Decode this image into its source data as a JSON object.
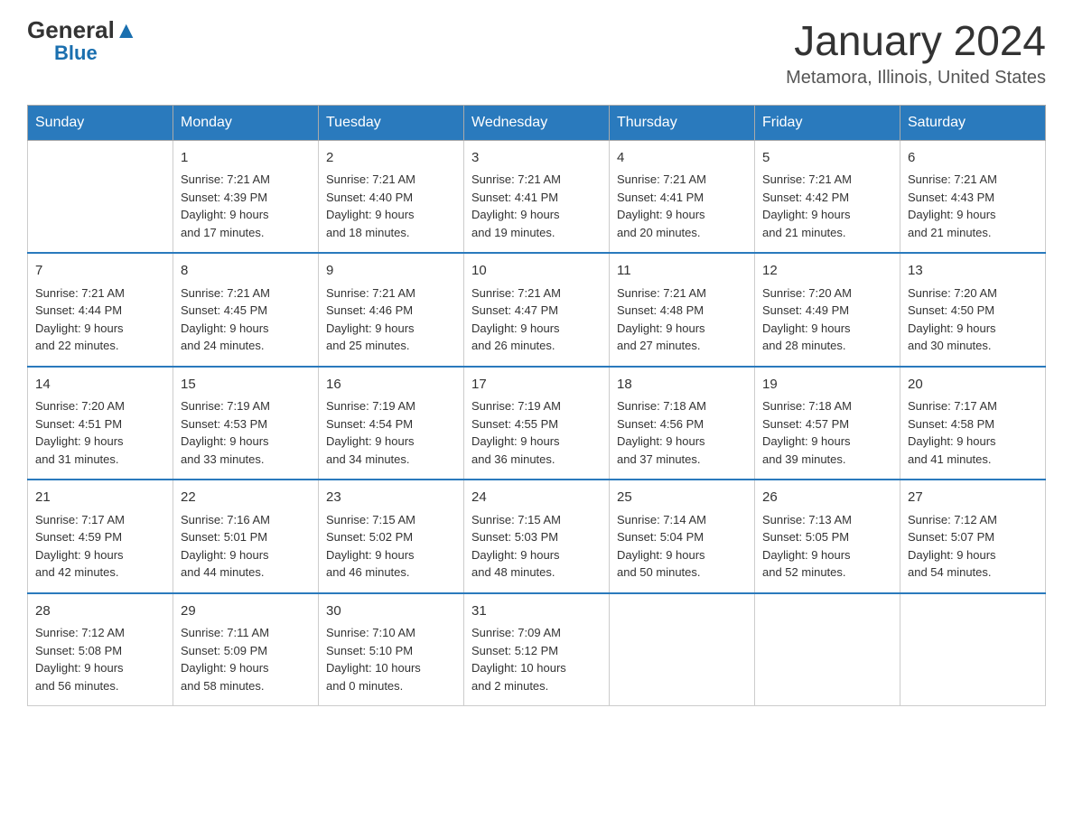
{
  "header": {
    "logo_general": "General",
    "logo_blue": "Blue",
    "title": "January 2024",
    "subtitle": "Metamora, Illinois, United States"
  },
  "days_of_week": [
    "Sunday",
    "Monday",
    "Tuesday",
    "Wednesday",
    "Thursday",
    "Friday",
    "Saturday"
  ],
  "weeks": [
    [
      {
        "day": "",
        "info": ""
      },
      {
        "day": "1",
        "info": "Sunrise: 7:21 AM\nSunset: 4:39 PM\nDaylight: 9 hours\nand 17 minutes."
      },
      {
        "day": "2",
        "info": "Sunrise: 7:21 AM\nSunset: 4:40 PM\nDaylight: 9 hours\nand 18 minutes."
      },
      {
        "day": "3",
        "info": "Sunrise: 7:21 AM\nSunset: 4:41 PM\nDaylight: 9 hours\nand 19 minutes."
      },
      {
        "day": "4",
        "info": "Sunrise: 7:21 AM\nSunset: 4:41 PM\nDaylight: 9 hours\nand 20 minutes."
      },
      {
        "day": "5",
        "info": "Sunrise: 7:21 AM\nSunset: 4:42 PM\nDaylight: 9 hours\nand 21 minutes."
      },
      {
        "day": "6",
        "info": "Sunrise: 7:21 AM\nSunset: 4:43 PM\nDaylight: 9 hours\nand 21 minutes."
      }
    ],
    [
      {
        "day": "7",
        "info": "Sunrise: 7:21 AM\nSunset: 4:44 PM\nDaylight: 9 hours\nand 22 minutes."
      },
      {
        "day": "8",
        "info": "Sunrise: 7:21 AM\nSunset: 4:45 PM\nDaylight: 9 hours\nand 24 minutes."
      },
      {
        "day": "9",
        "info": "Sunrise: 7:21 AM\nSunset: 4:46 PM\nDaylight: 9 hours\nand 25 minutes."
      },
      {
        "day": "10",
        "info": "Sunrise: 7:21 AM\nSunset: 4:47 PM\nDaylight: 9 hours\nand 26 minutes."
      },
      {
        "day": "11",
        "info": "Sunrise: 7:21 AM\nSunset: 4:48 PM\nDaylight: 9 hours\nand 27 minutes."
      },
      {
        "day": "12",
        "info": "Sunrise: 7:20 AM\nSunset: 4:49 PM\nDaylight: 9 hours\nand 28 minutes."
      },
      {
        "day": "13",
        "info": "Sunrise: 7:20 AM\nSunset: 4:50 PM\nDaylight: 9 hours\nand 30 minutes."
      }
    ],
    [
      {
        "day": "14",
        "info": "Sunrise: 7:20 AM\nSunset: 4:51 PM\nDaylight: 9 hours\nand 31 minutes."
      },
      {
        "day": "15",
        "info": "Sunrise: 7:19 AM\nSunset: 4:53 PM\nDaylight: 9 hours\nand 33 minutes."
      },
      {
        "day": "16",
        "info": "Sunrise: 7:19 AM\nSunset: 4:54 PM\nDaylight: 9 hours\nand 34 minutes."
      },
      {
        "day": "17",
        "info": "Sunrise: 7:19 AM\nSunset: 4:55 PM\nDaylight: 9 hours\nand 36 minutes."
      },
      {
        "day": "18",
        "info": "Sunrise: 7:18 AM\nSunset: 4:56 PM\nDaylight: 9 hours\nand 37 minutes."
      },
      {
        "day": "19",
        "info": "Sunrise: 7:18 AM\nSunset: 4:57 PM\nDaylight: 9 hours\nand 39 minutes."
      },
      {
        "day": "20",
        "info": "Sunrise: 7:17 AM\nSunset: 4:58 PM\nDaylight: 9 hours\nand 41 minutes."
      }
    ],
    [
      {
        "day": "21",
        "info": "Sunrise: 7:17 AM\nSunset: 4:59 PM\nDaylight: 9 hours\nand 42 minutes."
      },
      {
        "day": "22",
        "info": "Sunrise: 7:16 AM\nSunset: 5:01 PM\nDaylight: 9 hours\nand 44 minutes."
      },
      {
        "day": "23",
        "info": "Sunrise: 7:15 AM\nSunset: 5:02 PM\nDaylight: 9 hours\nand 46 minutes."
      },
      {
        "day": "24",
        "info": "Sunrise: 7:15 AM\nSunset: 5:03 PM\nDaylight: 9 hours\nand 48 minutes."
      },
      {
        "day": "25",
        "info": "Sunrise: 7:14 AM\nSunset: 5:04 PM\nDaylight: 9 hours\nand 50 minutes."
      },
      {
        "day": "26",
        "info": "Sunrise: 7:13 AM\nSunset: 5:05 PM\nDaylight: 9 hours\nand 52 minutes."
      },
      {
        "day": "27",
        "info": "Sunrise: 7:12 AM\nSunset: 5:07 PM\nDaylight: 9 hours\nand 54 minutes."
      }
    ],
    [
      {
        "day": "28",
        "info": "Sunrise: 7:12 AM\nSunset: 5:08 PM\nDaylight: 9 hours\nand 56 minutes."
      },
      {
        "day": "29",
        "info": "Sunrise: 7:11 AM\nSunset: 5:09 PM\nDaylight: 9 hours\nand 58 minutes."
      },
      {
        "day": "30",
        "info": "Sunrise: 7:10 AM\nSunset: 5:10 PM\nDaylight: 10 hours\nand 0 minutes."
      },
      {
        "day": "31",
        "info": "Sunrise: 7:09 AM\nSunset: 5:12 PM\nDaylight: 10 hours\nand 2 minutes."
      },
      {
        "day": "",
        "info": ""
      },
      {
        "day": "",
        "info": ""
      },
      {
        "day": "",
        "info": ""
      }
    ]
  ]
}
